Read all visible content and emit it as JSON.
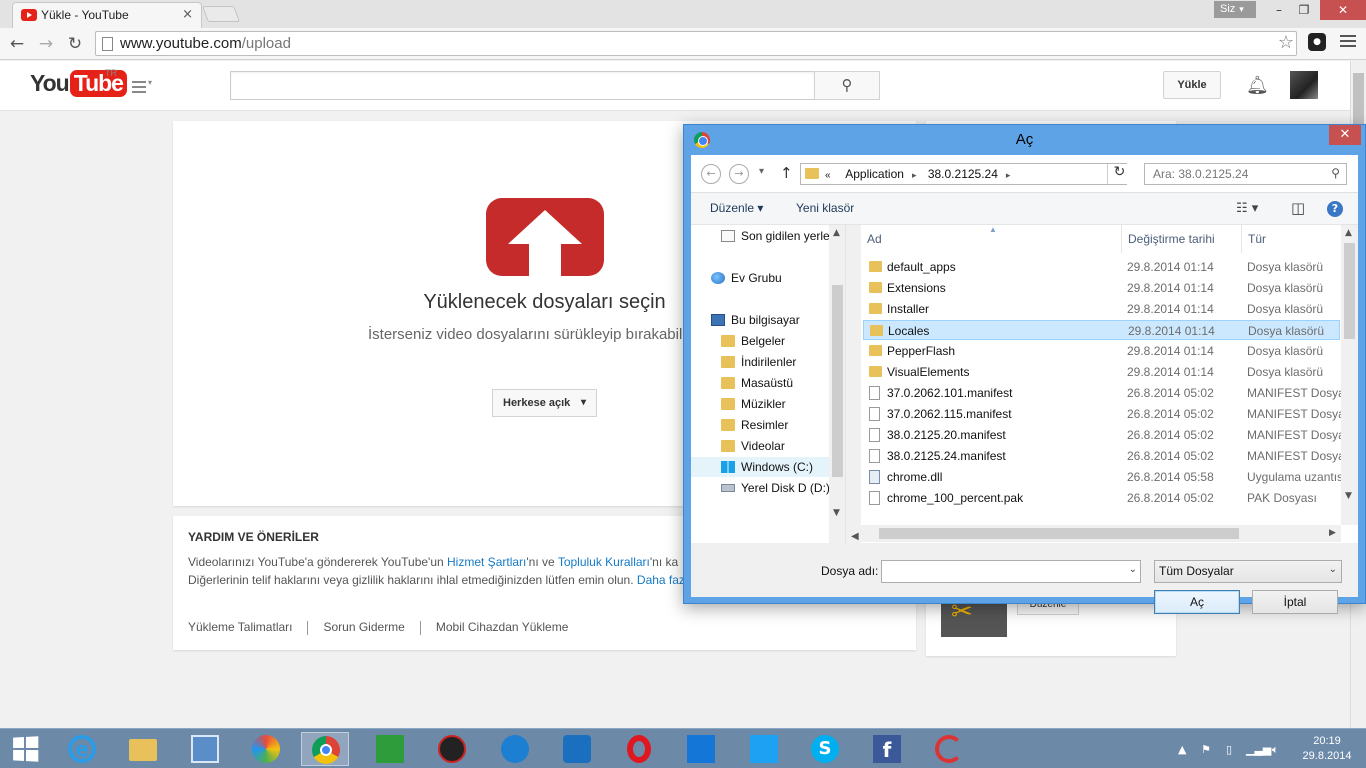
{
  "browser": {
    "tab_title": "Yükle - YouTube",
    "tab_close": "×",
    "user_label": "Siz",
    "minimize": "–",
    "maximize": "❐",
    "close": "✕",
    "url_host": "www.youtube.com",
    "url_path": "/upload",
    "back": "←",
    "forward": "→",
    "reload": "↻",
    "star": "☆"
  },
  "youtube": {
    "logo_you": "You",
    "logo_tube": "Tube",
    "country": "TR",
    "search_placeholder": "",
    "upload_button": "Yükle",
    "upload_title": "Yüklenecek dosyaları seçin",
    "upload_subtitle": "İsterseniz video dosyalarını sürükleyip bırakabil",
    "privacy": "Herkese açık",
    "help": {
      "title": "YARDIM VE ÖNERİLER",
      "line1_a": "Videolarınızı YouTube'a göndererek YouTube'un ",
      "line1_link1": "Hizmet Şartları",
      "line1_b": "'nı ve ",
      "line1_link2": "Topluluk Kuralları",
      "line1_c": "'nı ka",
      "line2_a": "Diğerlerinin telif haklarını veya gizlilik haklarını ihlal etmediğinizden lütfen emin olun. ",
      "line2_link": "Daha faz",
      "links": [
        "Yükleme Talimatları",
        "Sorun Giderme",
        "Mobil Cihazdan Yükleme"
      ]
    },
    "right_panel_button": "Düzenle"
  },
  "dialog": {
    "title": "Aç",
    "close": "✕",
    "breadcrumb_prefix": "«",
    "breadcrumbs": [
      "Application",
      "38.0.2125.24"
    ],
    "search_placeholder": "Ara: 38.0.2125.24",
    "organize": "Düzenle",
    "new_folder": "Yeni klasör",
    "nav_items": [
      {
        "label": "Son gidilen yerler",
        "icon": "recent"
      },
      {
        "label": "Ev Grubu",
        "icon": "group"
      },
      {
        "label": "Bu bilgisayar",
        "icon": "pc"
      },
      {
        "label": "Belgeler",
        "icon": "folder"
      },
      {
        "label": "İndirilenler",
        "icon": "folder"
      },
      {
        "label": "Masaüstü",
        "icon": "folder"
      },
      {
        "label": "Müzikler",
        "icon": "folder"
      },
      {
        "label": "Resimler",
        "icon": "folder"
      },
      {
        "label": "Videolar",
        "icon": "folder"
      },
      {
        "label": "Windows (C:)",
        "icon": "win",
        "selected": true
      },
      {
        "label": "Yerel Disk D (D:)",
        "icon": "drive"
      }
    ],
    "columns": [
      "Ad",
      "Değiştirme tarihi",
      "Tür"
    ],
    "files": [
      {
        "name": "default_apps",
        "date": "29.8.2014 01:14",
        "type": "Dosya klasörü",
        "icon": "folder"
      },
      {
        "name": "Extensions",
        "date": "29.8.2014 01:14",
        "type": "Dosya klasörü",
        "icon": "folder"
      },
      {
        "name": "Installer",
        "date": "29.8.2014 01:14",
        "type": "Dosya klasörü",
        "icon": "folder"
      },
      {
        "name": "Locales",
        "date": "29.8.2014 01:14",
        "type": "Dosya klasörü",
        "icon": "folder",
        "selected": true
      },
      {
        "name": "PepperFlash",
        "date": "29.8.2014 01:14",
        "type": "Dosya klasörü",
        "icon": "folder"
      },
      {
        "name": "VisualElements",
        "date": "29.8.2014 01:14",
        "type": "Dosya klasörü",
        "icon": "folder"
      },
      {
        "name": "37.0.2062.101.manifest",
        "date": "26.8.2014 05:02",
        "type": "MANIFEST Dosyası",
        "icon": "file"
      },
      {
        "name": "37.0.2062.115.manifest",
        "date": "26.8.2014 05:02",
        "type": "MANIFEST Dosyası",
        "icon": "file"
      },
      {
        "name": "38.0.2125.20.manifest",
        "date": "26.8.2014 05:02",
        "type": "MANIFEST Dosyası",
        "icon": "file"
      },
      {
        "name": "38.0.2125.24.manifest",
        "date": "26.8.2014 05:02",
        "type": "MANIFEST Dosyası",
        "icon": "file"
      },
      {
        "name": "chrome.dll",
        "date": "26.8.2014 05:58",
        "type": "Uygulama uzantısı",
        "icon": "dll"
      },
      {
        "name": "chrome_100_percent.pak",
        "date": "26.8.2014 05:02",
        "type": "PAK Dosyası",
        "icon": "file"
      }
    ],
    "filename_label": "Dosya adı:",
    "filename_value": "",
    "filetype": "Tüm Dosyalar",
    "open_button": "Aç",
    "cancel_button": "İptal"
  },
  "taskbar": {
    "time": "20:19",
    "date": "29.8.2014"
  }
}
